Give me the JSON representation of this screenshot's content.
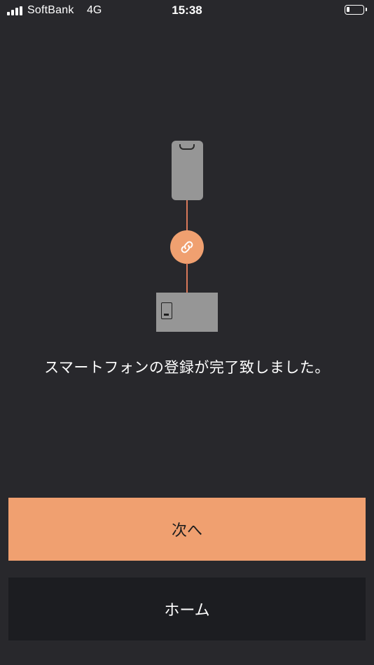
{
  "status_bar": {
    "carrier": "SoftBank",
    "network": "4G",
    "time": "15:38",
    "battery_level": 0.2
  },
  "illustration": {
    "icons": [
      "smartphone-icon",
      "link-icon",
      "device-icon"
    ],
    "accent_color": "#f0a070",
    "line_color": "#d9795a"
  },
  "message": "スマートフォンの登録が完了致しました。",
  "buttons": {
    "next_label": "次へ",
    "home_label": "ホーム"
  },
  "colors": {
    "background": "#28282c",
    "primary_button": "#f0a070",
    "secondary_button": "#1c1d21"
  }
}
